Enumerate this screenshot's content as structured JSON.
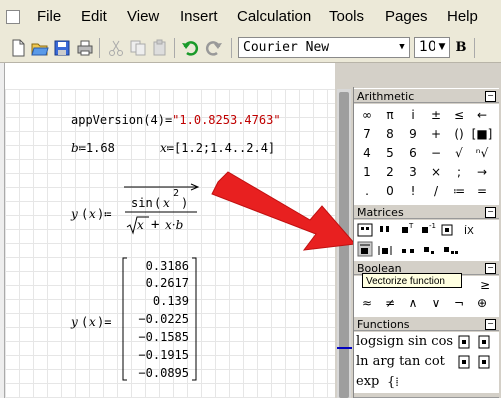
{
  "menu": [
    "File",
    "Edit",
    "View",
    "Insert",
    "Calculation",
    "Tools",
    "Pages",
    "Help"
  ],
  "toolbar": {
    "icons": [
      "new-document-icon",
      "open-folder-icon",
      "save-icon",
      "print-icon",
      "cut-icon",
      "copy-icon",
      "paste-icon",
      "undo-icon",
      "redo-icon"
    ],
    "font_name": "Courier New",
    "font_size": "10",
    "bold_label": "B"
  },
  "worksheet": {
    "app_version_fn": "appVersion",
    "app_version_arg": "4",
    "app_version_value": "\"1.0.8253.4763\"",
    "b_name": "b",
    "b_value": "1.68",
    "x_name": "x",
    "x_value": "[1.2;1.4..2.4]",
    "def_y": "y",
    "def_x": "x",
    "sin": "sin",
    "xvar": "x",
    "pow": "2",
    "sqrt_x": "x",
    "plus": "+",
    "x_times_b": "x·b",
    "result_y": "y",
    "result_x": "x",
    "vector_values": [
      "0.3186",
      "0.2617",
      "0.139",
      "−0.0225",
      "−0.1585",
      "−0.1915",
      "−0.0895"
    ]
  },
  "palettes": {
    "arithmetic": {
      "title": "Arithmetic",
      "rows": [
        [
          "∞",
          "π",
          "i",
          "±",
          "≤",
          "←"
        ],
        [
          "7",
          "8",
          "9",
          "+",
          "()",
          "[■]"
        ],
        [
          "4",
          "5",
          "6",
          "−",
          "√",
          "ⁿ√"
        ],
        [
          "1",
          "2",
          "3",
          "×",
          ";",
          "→"
        ],
        [
          ".",
          "0",
          "!",
          "/",
          "≔",
          "="
        ]
      ]
    },
    "matrices": {
      "title": "Matrices"
    },
    "boolean": {
      "title": "Boolean",
      "rows": [
        [
          "≈",
          "≠",
          "∧",
          "∨",
          "¬",
          "⊕"
        ]
      ],
      "top_right": "≥"
    },
    "functions": {
      "title": "Functions",
      "row1": "logsign sin cos",
      "row2": "ln  arg tan cot",
      "row3": "exp"
    },
    "tooltip": "Vectorize function"
  },
  "colors": {
    "string_red": "#c00000",
    "arrow_red": "#e82020"
  }
}
